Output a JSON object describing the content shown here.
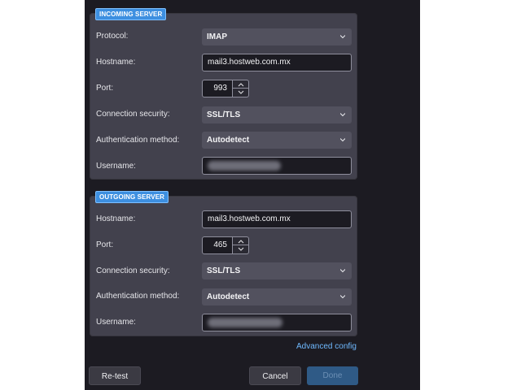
{
  "incoming": {
    "legend": "INCOMING SERVER",
    "protocol_label": "Protocol:",
    "protocol_value": "IMAP",
    "hostname_label": "Hostname:",
    "hostname_value": "mail3.hostweb.com.mx",
    "port_label": "Port:",
    "port_value": "993",
    "security_label": "Connection security:",
    "security_value": "SSL/TLS",
    "auth_label": "Authentication method:",
    "auth_value": "Autodetect",
    "username_label": "Username:"
  },
  "outgoing": {
    "legend": "OUTGOING SERVER",
    "hostname_label": "Hostname:",
    "hostname_value": "mail3.hostweb.com.mx",
    "port_label": "Port:",
    "port_value": "465",
    "security_label": "Connection security:",
    "security_value": "SSL/TLS",
    "auth_label": "Authentication method:",
    "auth_value": "Autodetect",
    "username_label": "Username:"
  },
  "advanced_config_link": "Advanced config",
  "buttons": {
    "retest": "Re-test",
    "cancel": "Cancel",
    "done": "Done"
  },
  "colors": {
    "dialog_bg": "#1c1b22",
    "group_bg": "#42414d",
    "legend_bg": "#3d8fe0",
    "link": "#6fb9ff",
    "primary_disabled": "#2f5a86"
  },
  "icons": [
    "chevron-down-icon",
    "spin-up-icon",
    "spin-down-icon"
  ]
}
